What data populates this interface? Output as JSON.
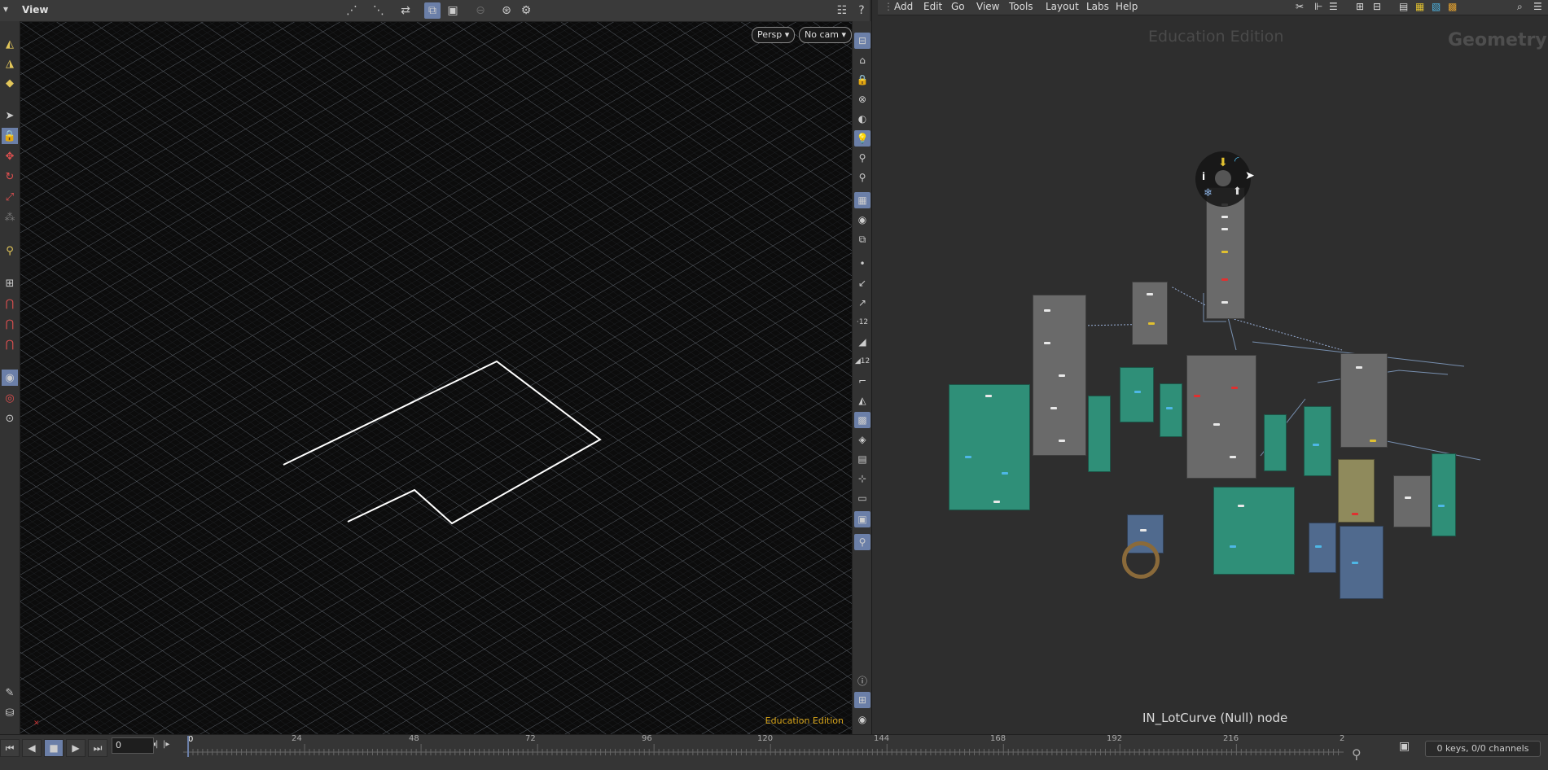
{
  "viewport": {
    "title": "View",
    "persp_label": "Persp",
    "cam_label": "No cam",
    "edu_label": "Education Edition"
  },
  "network": {
    "menu": [
      "Add",
      "Edit",
      "Go",
      "View",
      "Tools",
      "Layout",
      "Labs",
      "Help"
    ],
    "edu_label": "Education Edition",
    "context_label": "Geometry",
    "status": "IN_LotCurve (Null) node"
  },
  "timeline": {
    "current_frame": "0",
    "frame_marker": "0",
    "ticks": [
      "24",
      "48",
      "72",
      "96",
      "120",
      "144",
      "168",
      "192",
      "216",
      "2"
    ],
    "keys_info": "0 keys, 0/0 channels"
  },
  "colors": {
    "accent": "#6b7fa8",
    "edu_viewport": "#d6a318",
    "teal_box": "#2f8f78",
    "gray_box": "#6a6a6a",
    "blue_box": "#506a8e",
    "tan_box": "#8f8a5c"
  }
}
